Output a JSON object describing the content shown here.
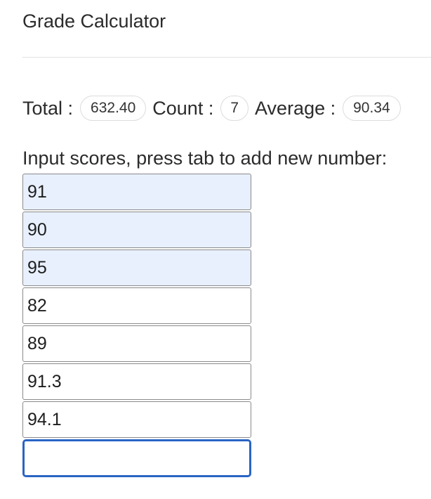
{
  "app": {
    "title": "Grade Calculator"
  },
  "stats": {
    "total_label": "Total :",
    "total_value": "632.40",
    "count_label": "Count :",
    "count_value": "7",
    "average_label": "Average :",
    "average_value": "90.34"
  },
  "instruction": "Input scores, press tab to add new number:",
  "scores": {
    "items": [
      {
        "value": "91",
        "autofilled": true
      },
      {
        "value": "90",
        "autofilled": true
      },
      {
        "value": "95",
        "autofilled": true
      },
      {
        "value": "82",
        "autofilled": false
      },
      {
        "value": "89",
        "autofilled": false
      },
      {
        "value": "91.3",
        "autofilled": false
      },
      {
        "value": "94.1",
        "autofilled": false
      }
    ],
    "new_entry": {
      "value": "",
      "focused": true
    }
  },
  "colors": {
    "autofill_background": "#e8f0fe",
    "focus_border": "#2a64c5",
    "input_border": "#8a8a8a"
  }
}
